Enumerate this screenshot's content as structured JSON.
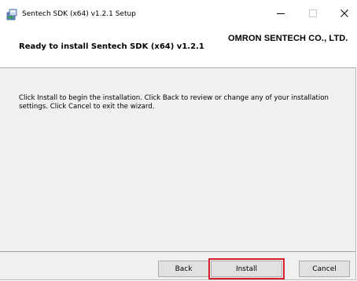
{
  "window": {
    "title": "Sentech SDK (x64) v1.2.1 Setup",
    "icons": {
      "app": "installer-icon",
      "minimize": "minimize-icon",
      "maximize": "maximize-icon",
      "close": "close-icon"
    }
  },
  "header": {
    "company": "OMRON SENTECH CO., LTD.",
    "heading": "Ready to install Sentech SDK (x64) v1.2.1"
  },
  "body": {
    "instructions": "Click Install to begin the installation. Click Back to review or change any of your installation settings. Click Cancel to exit the wizard."
  },
  "footer": {
    "back_label": "Back",
    "install_label": "Install",
    "cancel_label": "Cancel"
  },
  "colors": {
    "focus_highlight": "#d6202c",
    "panel_bg": "#f0f0f0"
  }
}
